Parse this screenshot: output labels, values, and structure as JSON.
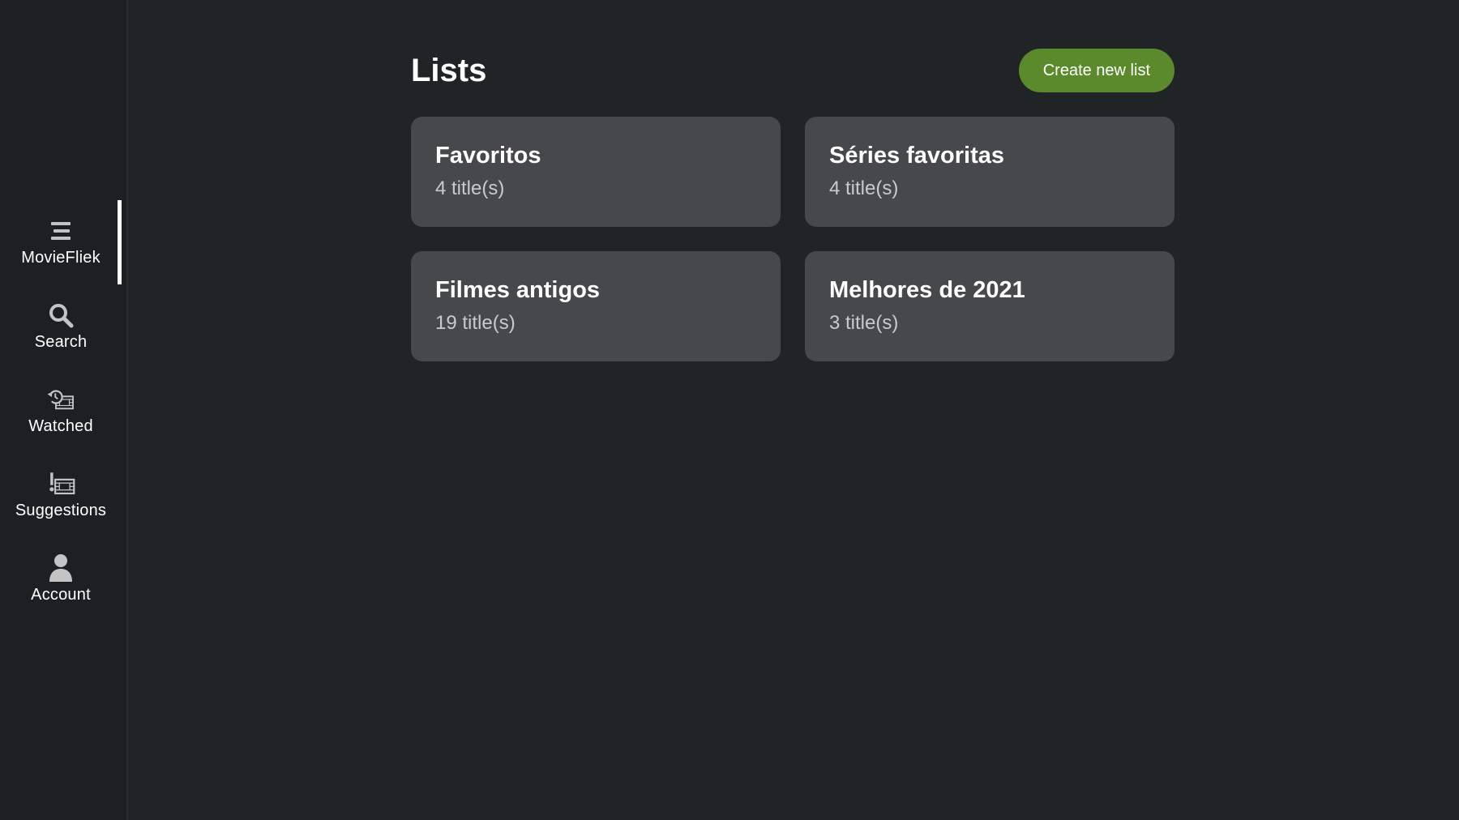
{
  "sidebar": {
    "items": [
      {
        "label": "MovieFliek",
        "icon": "menu-icon",
        "active": true
      },
      {
        "label": "Search",
        "icon": "search-icon",
        "active": false
      },
      {
        "label": "Watched",
        "icon": "watched-history-icon",
        "active": false
      },
      {
        "label": "Suggestions",
        "icon": "suggestions-icon",
        "active": false
      },
      {
        "label": "Account",
        "icon": "account-icon",
        "active": false
      }
    ]
  },
  "main": {
    "title": "Lists",
    "create_label": "Create new list",
    "lists": [
      {
        "name": "Favoritos",
        "count": "4 title(s)"
      },
      {
        "name": "Séries favoritas",
        "count": "4 title(s)"
      },
      {
        "name": "Filmes antigos",
        "count": "19 title(s)"
      },
      {
        "name": "Melhores de 2021",
        "count": "3 title(s)"
      }
    ]
  },
  "colors": {
    "background": "#212427",
    "sidebar": "#1d2023",
    "card": "#46484c",
    "accent": "#5b8a2d",
    "muted_text": "#c9cacc",
    "icon": "#c4c4c4"
  }
}
